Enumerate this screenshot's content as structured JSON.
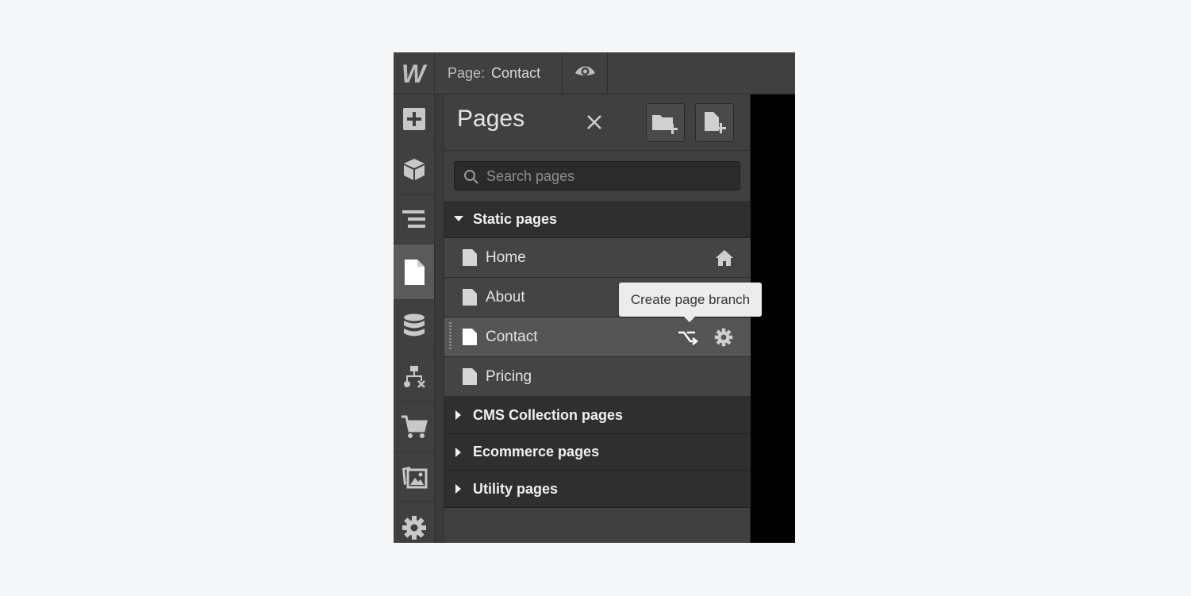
{
  "topbar": {
    "logo_text": "W",
    "page_label": "Page:",
    "page_name": "Contact",
    "preview_icon": "eye-icon"
  },
  "rail": [
    {
      "icon": "add-icon",
      "active": false
    },
    {
      "icon": "cube-icon",
      "active": false
    },
    {
      "icon": "navigator-icon",
      "active": false
    },
    {
      "icon": "page-icon",
      "active": true
    },
    {
      "icon": "database-icon",
      "active": false
    },
    {
      "icon": "logic-flow-icon",
      "active": false
    },
    {
      "icon": "cart-icon",
      "active": false
    },
    {
      "icon": "assets-icon",
      "active": false
    },
    {
      "icon": "settings-icon",
      "active": false
    }
  ],
  "panel": {
    "title": "Pages",
    "close_icon": "close-icon",
    "new_folder_icon": "folder-add-icon",
    "new_page_icon": "page-add-icon",
    "search_placeholder": "Search pages",
    "static_section": "Static pages",
    "pages": [
      {
        "name": "Home",
        "icon": "home-icon"
      },
      {
        "name": "About"
      },
      {
        "name": "Contact",
        "selected": true
      },
      {
        "name": "Pricing"
      }
    ],
    "collapsed_sections": [
      "CMS Collection pages",
      "Ecommerce pages",
      "Utility pages"
    ]
  },
  "tooltip": "Create page branch",
  "colors": {
    "accent_bg": "#404040",
    "dark_bg": "#2f2f2f",
    "canvas": "#000000"
  }
}
